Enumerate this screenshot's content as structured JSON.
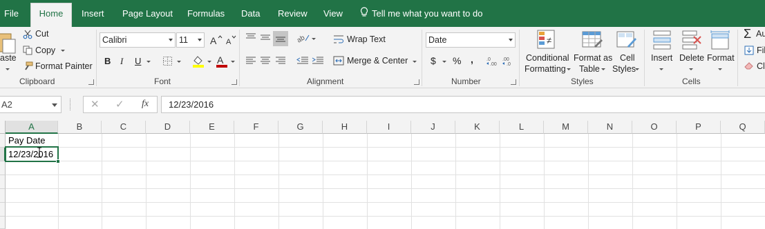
{
  "tabs": {
    "file": "File",
    "home": "Home",
    "insert": "Insert",
    "page_layout": "Page Layout",
    "formulas": "Formulas",
    "data": "Data",
    "review": "Review",
    "view": "View",
    "tell_me": "Tell me what you want to do"
  },
  "clipboard": {
    "paste": "aste",
    "cut": "Cut",
    "copy": "Copy",
    "format_painter": "Format Painter",
    "label": "Clipboard"
  },
  "font": {
    "name": "Calibri",
    "size": "11",
    "bold": "B",
    "italic": "I",
    "underline": "U",
    "label": "Font"
  },
  "alignment": {
    "wrap_text": "Wrap Text",
    "merge_center": "Merge & Center",
    "label": "Alignment"
  },
  "number": {
    "format": "Date",
    "currency": "$",
    "percent": "%",
    "comma": ",",
    "label": "Number"
  },
  "styles": {
    "conditional_1": "Conditional",
    "conditional_2": "Formatting",
    "format_as_1": "Format as",
    "format_as_2": "Table",
    "cell_styles_1": "Cell",
    "cell_styles_2": "Styles",
    "label": "Styles"
  },
  "cells": {
    "insert": "Insert",
    "delete": "Delete",
    "format": "Format",
    "label": "Cells"
  },
  "editing": {
    "autosum": "Au",
    "fill": "Fil",
    "clear": "Cl"
  },
  "formula_bar": {
    "name_box": "A2",
    "fx": "fx",
    "cancel": "✕",
    "enter": "✓",
    "value": "12/23/2016"
  },
  "columns": [
    "A",
    "B",
    "C",
    "D",
    "E",
    "F",
    "G",
    "H",
    "I",
    "J",
    "K",
    "L",
    "M",
    "N",
    "O",
    "P",
    "Q"
  ],
  "cells_data": {
    "A1": "Pay Date",
    "A2": "12/23/2016"
  },
  "colors": {
    "brand": "#217346",
    "font_color": "#c00000",
    "fill_color": "#ffff00"
  }
}
